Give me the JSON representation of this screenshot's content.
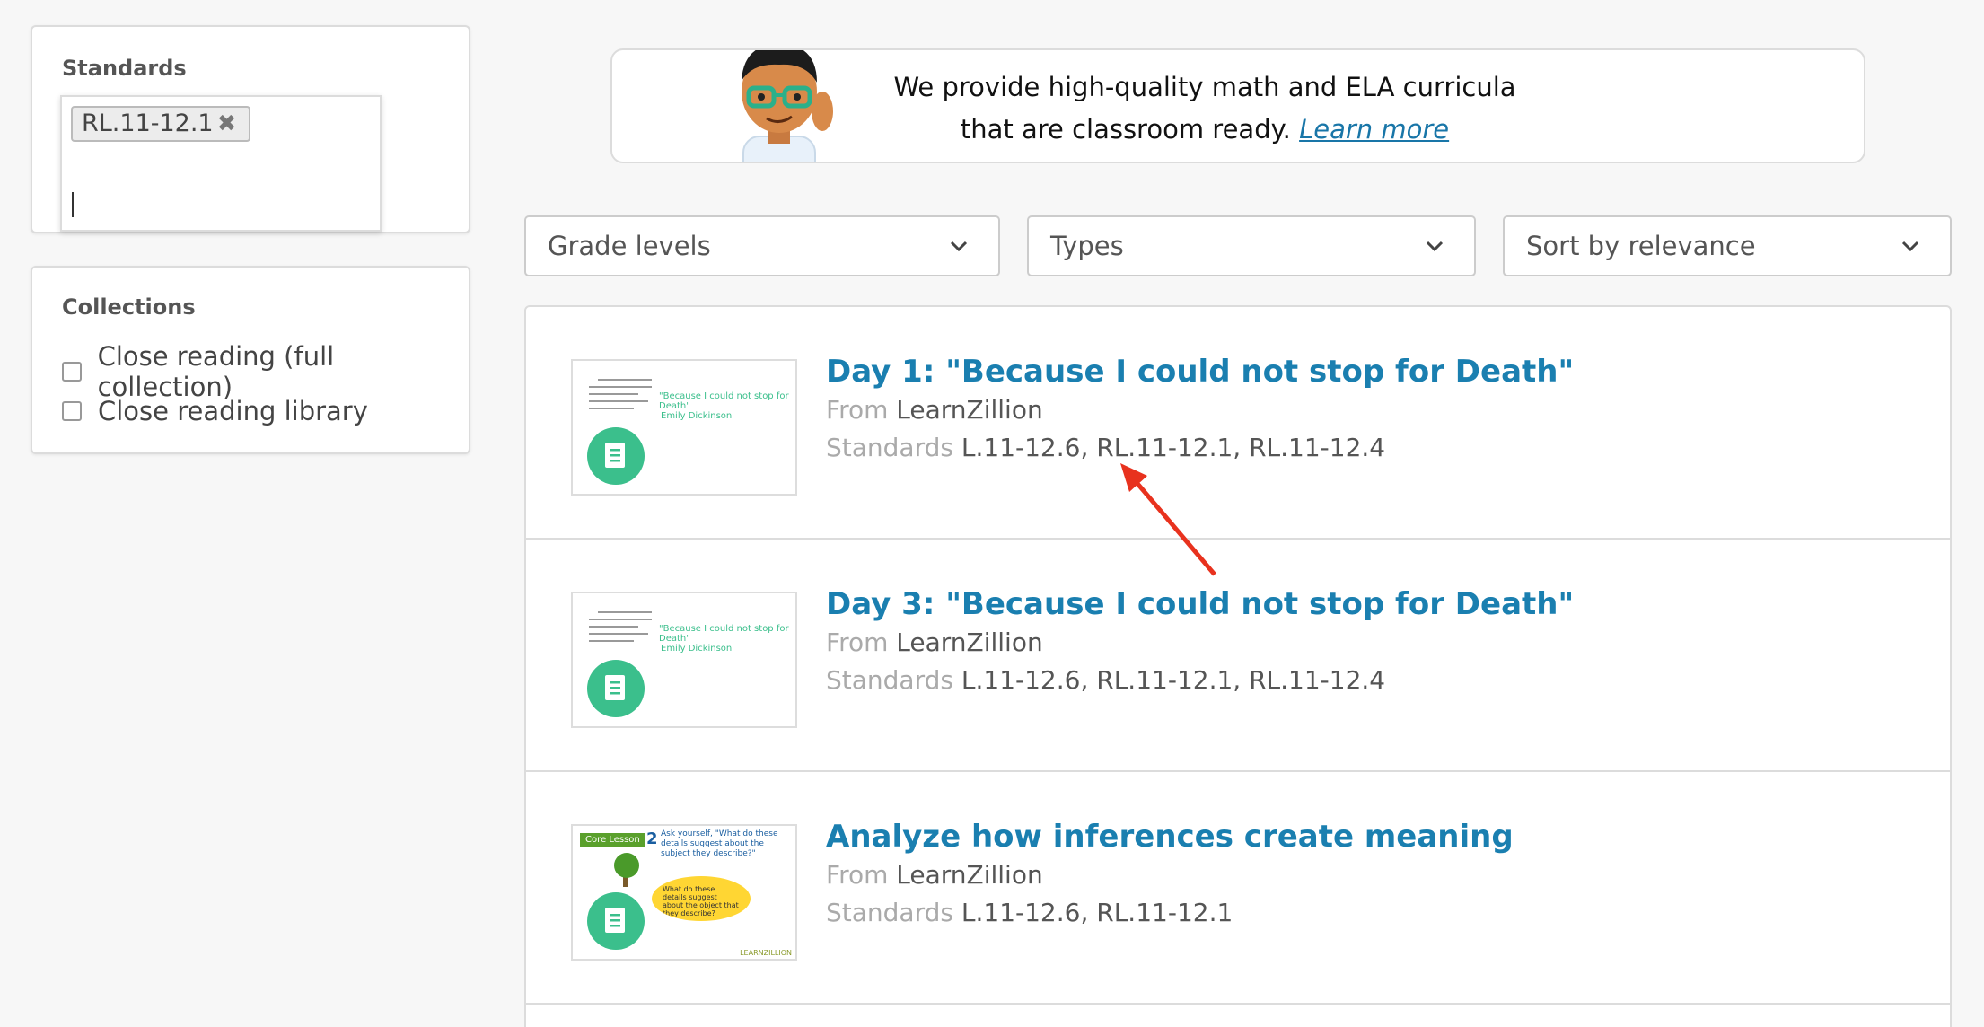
{
  "sidebar": {
    "standards": {
      "title": "Standards",
      "tag": "RL.11-12.1",
      "tag_remove_icon": "close-icon"
    },
    "collections": {
      "title": "Collections",
      "items": [
        {
          "label": "Close reading (full collection)",
          "checked": false
        },
        {
          "label": "Close reading library",
          "checked": false
        }
      ]
    }
  },
  "banner": {
    "line1": "We provide high-quality math and ELA curricula",
    "line2": "that are classroom ready.",
    "link": "Learn more"
  },
  "filters": {
    "grade": "Grade levels",
    "types": "Types",
    "sort": "Sort by relevance"
  },
  "results": [
    {
      "title": "Day 1: \"Because I could not stop for Death\"",
      "from_label": "From",
      "from": "LearnZillion",
      "std_label": "Standards",
      "standards": "L.11-12.6, RL.11-12.1, RL.11-12.4",
      "thumb_title": "\"Because I could not stop for Death\"",
      "thumb_author": "Emily Dickinson"
    },
    {
      "title": "Day 3: \"Because I could not stop for Death\"",
      "from_label": "From",
      "from": "LearnZillion",
      "std_label": "Standards",
      "standards": "L.11-12.6, RL.11-12.1, RL.11-12.4",
      "thumb_title": "\"Because I could not stop for Death\"",
      "thumb_author": "Emily Dickinson"
    },
    {
      "title": "Analyze how inferences create meaning",
      "from_label": "From",
      "from": "LearnZillion",
      "std_label": "Standards",
      "standards": "L.11-12.6, RL.11-12.1",
      "thumb_core": "Core Lesson",
      "thumb_num": "2",
      "thumb_prompt": "Ask yourself, \"What do these details suggest about the subject they describe?\"",
      "thumb_bubble": "What do these details suggest about the object that they describe?",
      "thumb_logo": "LEARNZILLION"
    }
  ],
  "colors": {
    "link_blue": "#1a7fb0",
    "badge_green": "#3bbf8c",
    "annotation_red": "#e8321e"
  }
}
